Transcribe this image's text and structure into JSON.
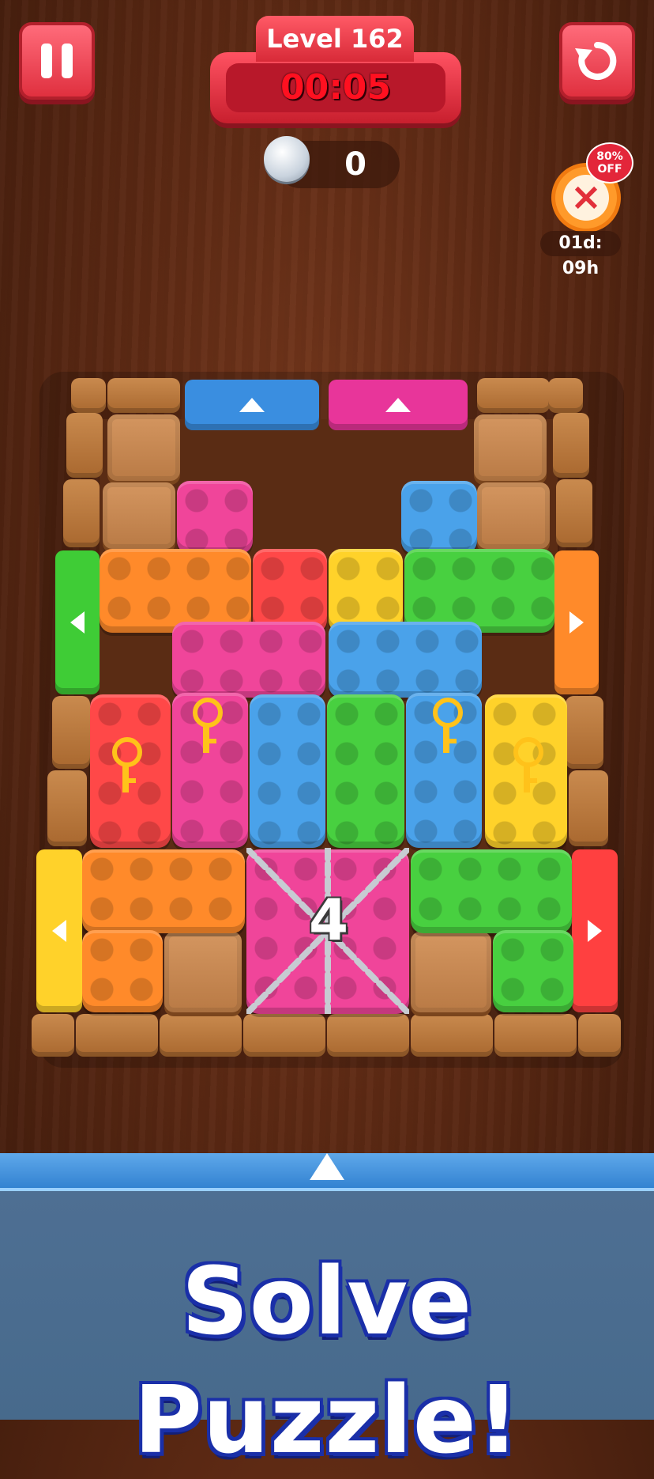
{
  "hud": {
    "level_label": "Level 162",
    "timer": "00:05",
    "screw_count": "0",
    "offer_badge": "80% OFF",
    "offer_timer": "01d: 09h"
  },
  "board": {
    "lock_counter": "4"
  },
  "banner": {
    "headline": "Solve Puzzle!"
  },
  "colors": {
    "orange": "#ff8a2a",
    "pink": "#f0459a",
    "red": "#ff4848",
    "yellow": "#ffd22a",
    "green": "#48d040",
    "blue": "#4aa2ea"
  },
  "icons": {
    "pause": "pause-icon",
    "restart": "restart-icon",
    "screw": "screw-icon",
    "offer": "alarm-clock-icon",
    "key": "key-icon",
    "chain": "chain-icon"
  }
}
